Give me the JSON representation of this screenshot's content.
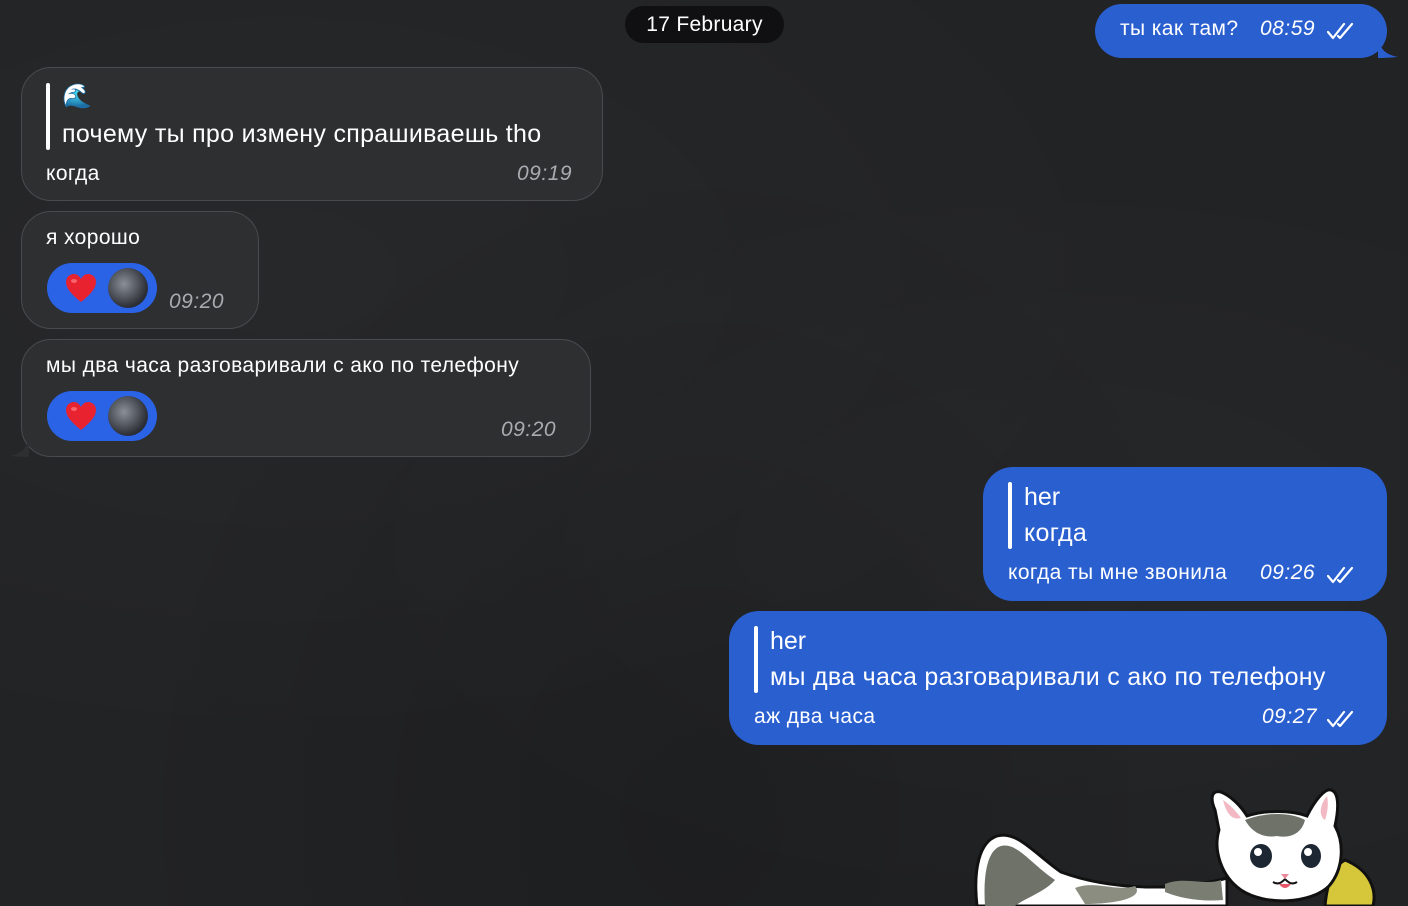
{
  "date_separator": "17 February",
  "messages": [
    {
      "direction": "out",
      "text": "ты как там?",
      "time": "08:59",
      "status": "read"
    },
    {
      "direction": "in",
      "quote": {
        "name_emoji": "🌊",
        "text": "почему ты про измену спрашиваешь tho"
      },
      "text": "когда",
      "time": "09:19"
    },
    {
      "direction": "in",
      "text": "я хорошо",
      "time": "09:20",
      "reaction": {
        "emoji": "heart-icon"
      }
    },
    {
      "direction": "in",
      "text": "мы два часа разговаривали с ако по телефону",
      "time": "09:20",
      "reaction": {
        "emoji": "heart-icon"
      }
    },
    {
      "direction": "out",
      "quote": {
        "name": "her",
        "text": "когда"
      },
      "text": "когда ты мне звонила",
      "time": "09:26",
      "status": "read"
    },
    {
      "direction": "out",
      "quote": {
        "name": "her",
        "text": "мы два часа разговаривали с ако по телефону"
      },
      "text": "аж два часа",
      "time": "09:27",
      "status": "read"
    }
  ],
  "colors": {
    "background": "#222325",
    "incoming_bubble": "#2e2f31",
    "outgoing_bubble": "#2a5fd0",
    "reaction": "#2a63e6"
  }
}
